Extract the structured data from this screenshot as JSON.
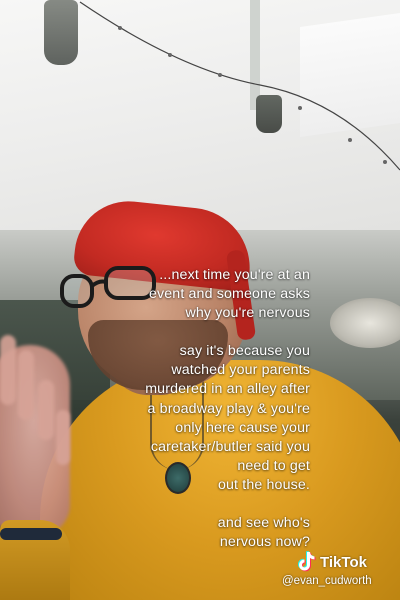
{
  "caption": {
    "paragraph_1": "...next time you're at an\nevent and someone asks\nwhy you're nervous",
    "paragraph_2": "say it's because you\nwatched your parents\nmurdered in an alley after\na broadway play & you're\nonly here cause your\ncaretaker/butler said you\nneed to get\nout the house.",
    "paragraph_3": "and see who's\nnervous now?"
  },
  "watermark": {
    "brand": "TikTok",
    "handle": "@evan_cudworth",
    "icon": "tiktok-logo-icon"
  },
  "colors": {
    "beanie": "#c22a22",
    "sweater": "#d99a1f",
    "caption_text": "#ffffff"
  }
}
